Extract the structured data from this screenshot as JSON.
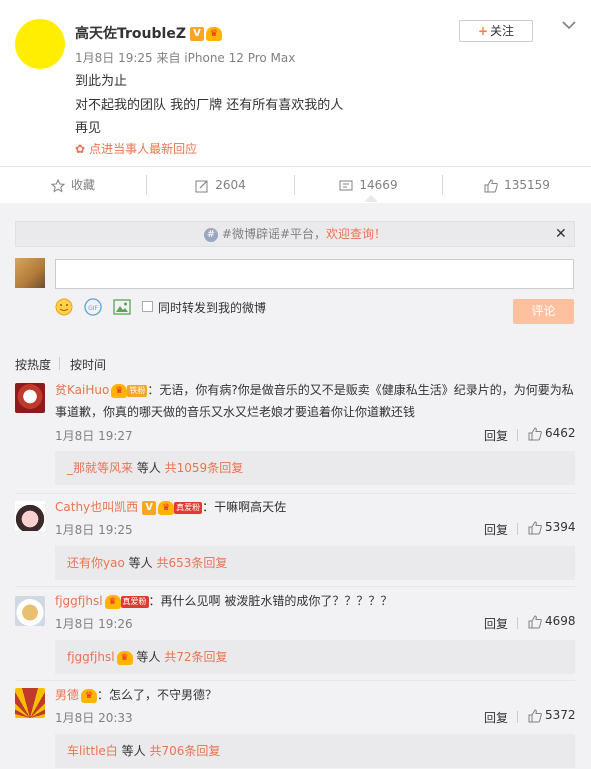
{
  "post": {
    "author": "高天佐TroubleZ",
    "verified_badge": "V",
    "meta": "1月8日 19:25 来自 iPhone 12 Pro Max",
    "lines": [
      "到此为止",
      "对不起我的团队 我的厂牌 还有所有喜欢我的人",
      "再见"
    ],
    "latest_reply_label": "点进当事人最新回应",
    "follow_label": "关注",
    "accent_color": "#eb7350"
  },
  "actions": {
    "favorite": "收藏",
    "repost_count": "2604",
    "comment_count": "14669",
    "like_count": "135159"
  },
  "notice": {
    "prefix": "#微博辟谣#平台，",
    "highlight": "欢迎查询！"
  },
  "composer": {
    "repost_label": "同时转发到我的微博",
    "submit_label": "评论"
  },
  "sort": {
    "hot": "按热度",
    "time": "按时间"
  },
  "comments": [
    {
      "user": "贫KaiHuo",
      "badge": "铁粉",
      "text": "：无语，你有病?你是做音乐的又不是贩卖《健康私生活》纪录片的，为何要为私事道歉，你真的哪天做的音乐又水又烂老娘才要追着你让你道歉还钱",
      "time": "1月8日 19:27",
      "reply": "回复",
      "likes": "6462",
      "sub_user": "_那就等风来",
      "sub_mid": " 等人 ",
      "sub_count": "共1059条回复"
    },
    {
      "user": "Cathy也叫凯西",
      "badge": "真爱粉",
      "text": "：干嘛啊高天佐",
      "time": "1月8日 19:25",
      "reply": "回复",
      "likes": "5394",
      "sub_user": "还有你yao",
      "sub_mid": " 等人 ",
      "sub_count": "共653条回复"
    },
    {
      "user": "fjggfjhsl",
      "badge": "真爱粉",
      "text": "：再什么见啊 被泼脏水错的成你了？？？？？",
      "time": "1月8日 19:26",
      "reply": "回复",
      "likes": "4698",
      "sub_user": "fjggfjhsl",
      "sub_mid": " 等人 ",
      "sub_count": "共72条回复"
    },
    {
      "user": "男德",
      "badge": "",
      "text": "：怎么了，不守男德？",
      "time": "1月8日 20:33",
      "reply": "回复",
      "likes": "5372",
      "sub_user": "车little白",
      "sub_mid": " 等人 ",
      "sub_count": "共706条回复"
    }
  ]
}
